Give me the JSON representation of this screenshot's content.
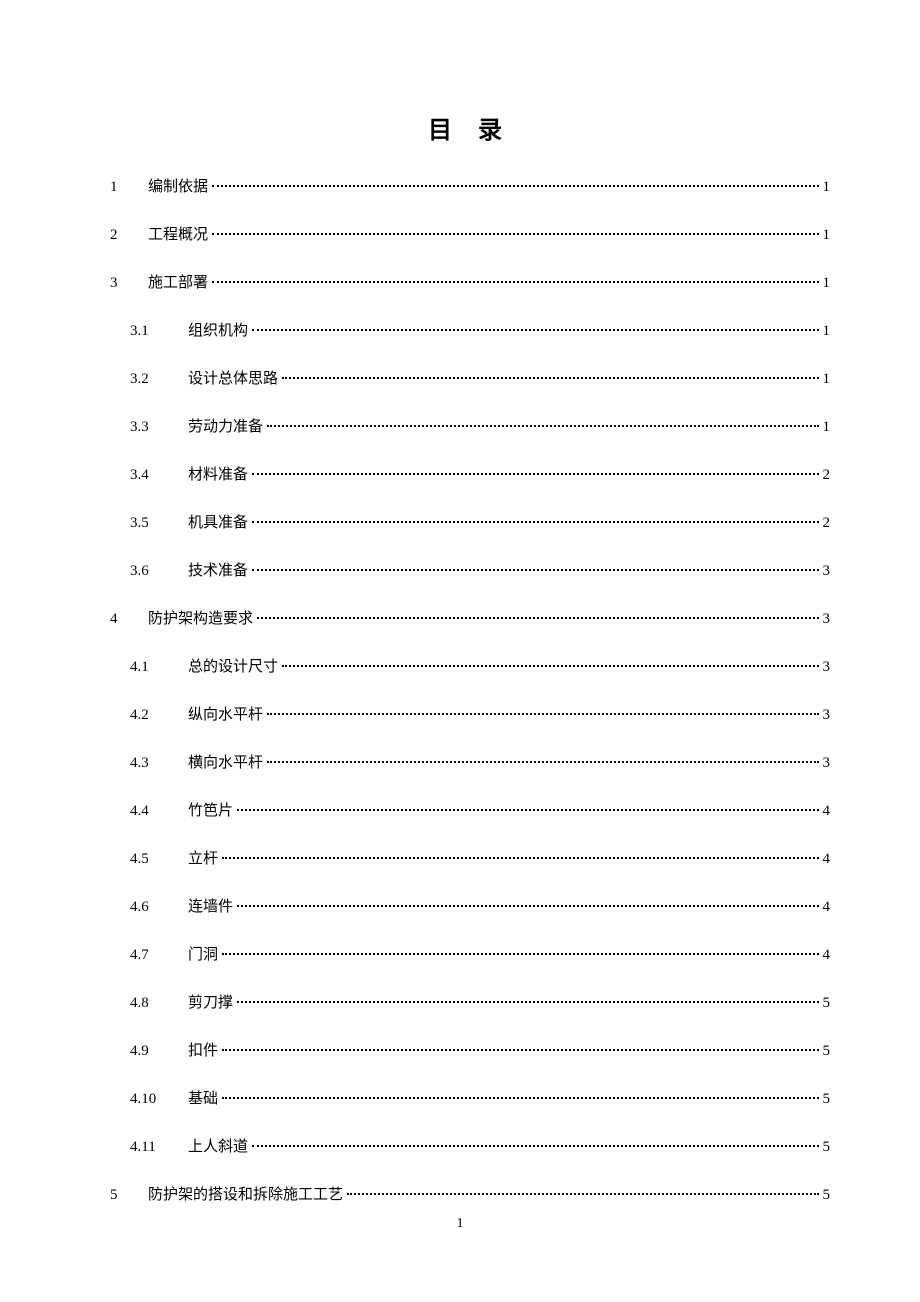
{
  "title": "目 录",
  "footer_page": "1",
  "toc": [
    {
      "level": 1,
      "num": "1",
      "label": "编制依据",
      "page": "1"
    },
    {
      "level": 1,
      "num": "2",
      "label": "工程概况",
      "page": "1"
    },
    {
      "level": 1,
      "num": "3",
      "label": "施工部署",
      "page": "1"
    },
    {
      "level": 2,
      "num": "3.1",
      "label": "组织机构",
      "page": "1"
    },
    {
      "level": 2,
      "num": "3.2",
      "label": "设计总体思路",
      "page": "1"
    },
    {
      "level": 2,
      "num": "3.3",
      "label": "劳动力准备",
      "page": "1"
    },
    {
      "level": 2,
      "num": "3.4",
      "label": "材料准备",
      "page": "2"
    },
    {
      "level": 2,
      "num": "3.5",
      "label": "机具准备",
      "page": "2"
    },
    {
      "level": 2,
      "num": "3.6",
      "label": "技术准备",
      "page": "3"
    },
    {
      "level": 1,
      "num": "4",
      "label": "防护架构造要求",
      "page": "3"
    },
    {
      "level": 2,
      "num": "4.1",
      "label": "总的设计尺寸",
      "page": "3"
    },
    {
      "level": 2,
      "num": "4.2",
      "label": "纵向水平杆",
      "page": "3"
    },
    {
      "level": 2,
      "num": "4.3",
      "label": "横向水平杆",
      "page": "3"
    },
    {
      "level": 2,
      "num": "4.4",
      "label": "竹笆片",
      "page": "4"
    },
    {
      "level": 2,
      "num": "4.5",
      "label": "立杆",
      "page": "4"
    },
    {
      "level": 2,
      "num": "4.6",
      "label": "连墙件",
      "page": "4"
    },
    {
      "level": 2,
      "num": "4.7",
      "label": "门洞",
      "page": "4"
    },
    {
      "level": 2,
      "num": "4.8",
      "label": "剪刀撑",
      "page": "5"
    },
    {
      "level": 2,
      "num": "4.9",
      "label": "扣件",
      "page": "5"
    },
    {
      "level": 2,
      "num": "4.10",
      "label": "基础",
      "page": "5"
    },
    {
      "level": 2,
      "num": "4.11",
      "label": "上人斜道",
      "page": "5"
    },
    {
      "level": 1,
      "num": "5",
      "label": "防护架的搭设和拆除施工工艺",
      "page": "5"
    }
  ]
}
